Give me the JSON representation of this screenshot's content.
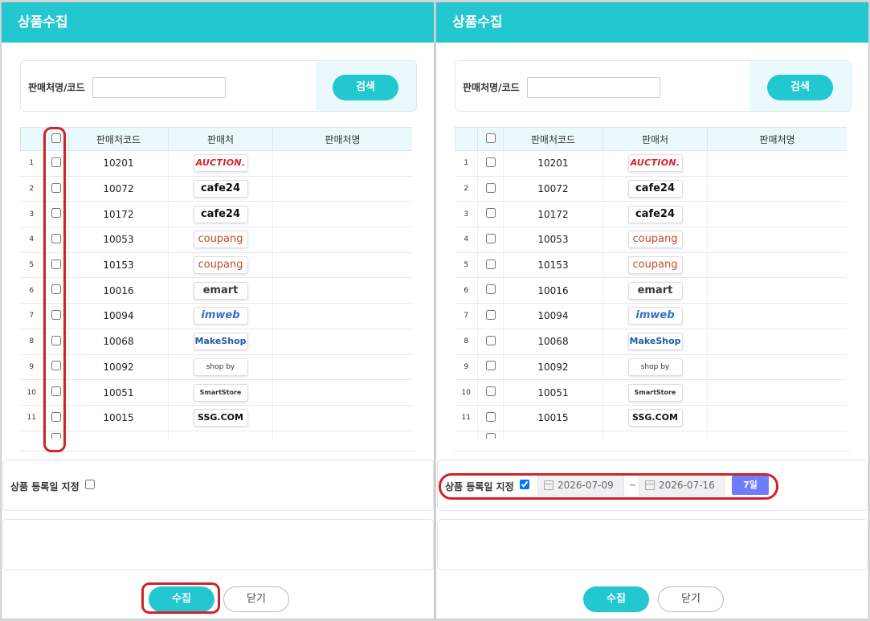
{
  "left_panel": {
    "title": "상품수집",
    "search": {
      "label": "판매처명/코드",
      "value": "",
      "button": "검색"
    },
    "table": {
      "headers": [
        "판매처코드",
        "판매처",
        "판매처명"
      ],
      "rows": [
        {
          "no": "1",
          "code": "10201",
          "logo": "AUCTION.",
          "logo_icon": "auction-logo"
        },
        {
          "no": "2",
          "code": "10072",
          "logo": "cafe24",
          "logo_icon": "cafe24-logo"
        },
        {
          "no": "3",
          "code": "10172",
          "logo": "cafe24",
          "logo_icon": "cafe24-logo"
        },
        {
          "no": "4",
          "code": "10053",
          "logo": "coupang",
          "logo_icon": "coupang-logo"
        },
        {
          "no": "5",
          "code": "10153",
          "logo": "coupang",
          "logo_icon": "coupang-logo"
        },
        {
          "no": "6",
          "code": "10016",
          "logo": "emart",
          "logo_icon": "emart-logo"
        },
        {
          "no": "7",
          "code": "10094",
          "logo": "imweb",
          "logo_icon": "imweb-logo"
        },
        {
          "no": "8",
          "code": "10068",
          "logo": "MakeShop",
          "logo_icon": "makeshop-logo"
        },
        {
          "no": "9",
          "code": "10092",
          "logo": "shop by",
          "logo_icon": "shopby-logo"
        },
        {
          "no": "10",
          "code": "10051",
          "logo": "SmartStore",
          "logo_icon": "smartstore-logo"
        },
        {
          "no": "11",
          "code": "10015",
          "logo": "SSG.COM",
          "logo_icon": "ssg-logo"
        }
      ]
    },
    "date_filter": {
      "label": "상품 등록일 지정",
      "checked": false
    },
    "buttons": {
      "collect": "수집",
      "close": "닫기"
    }
  },
  "right_panel": {
    "title": "상품수집",
    "search": {
      "label": "판매처명/코드",
      "value": "",
      "button": "검색"
    },
    "table": {
      "headers": [
        "판매처코드",
        "판매처",
        "판매처명"
      ],
      "rows": [
        {
          "no": "1",
          "code": "10201",
          "logo": "AUCTION.",
          "logo_icon": "auction-logo"
        },
        {
          "no": "2",
          "code": "10072",
          "logo": "cafe24",
          "logo_icon": "cafe24-logo"
        },
        {
          "no": "3",
          "code": "10172",
          "logo": "cafe24",
          "logo_icon": "cafe24-logo"
        },
        {
          "no": "4",
          "code": "10053",
          "logo": "coupang",
          "logo_icon": "coupang-logo"
        },
        {
          "no": "5",
          "code": "10153",
          "logo": "coupang",
          "logo_icon": "coupang-logo"
        },
        {
          "no": "6",
          "code": "10016",
          "logo": "emart",
          "logo_icon": "emart-logo"
        },
        {
          "no": "7",
          "code": "10094",
          "logo": "imweb",
          "logo_icon": "imweb-logo"
        },
        {
          "no": "8",
          "code": "10068",
          "logo": "MakeShop",
          "logo_icon": "makeshop-logo"
        },
        {
          "no": "9",
          "code": "10092",
          "logo": "shop by",
          "logo_icon": "shopby-logo"
        },
        {
          "no": "10",
          "code": "10051",
          "logo": "SmartStore",
          "logo_icon": "smartstore-logo"
        },
        {
          "no": "11",
          "code": "10015",
          "logo": "SSG.COM",
          "logo_icon": "ssg-logo"
        }
      ]
    },
    "date_filter": {
      "label": "상품 등록일 지정",
      "checked": true,
      "start_date": "2026-07-09",
      "separator": "~",
      "end_date": "2026-07-16",
      "range_button": "7일"
    },
    "buttons": {
      "collect": "수집",
      "close": "닫기"
    }
  },
  "colors": {
    "accent": "#22c7d0",
    "header_bg": "#eafafc",
    "highlight_red": "#d32227",
    "range_button": "#6f7cff"
  }
}
